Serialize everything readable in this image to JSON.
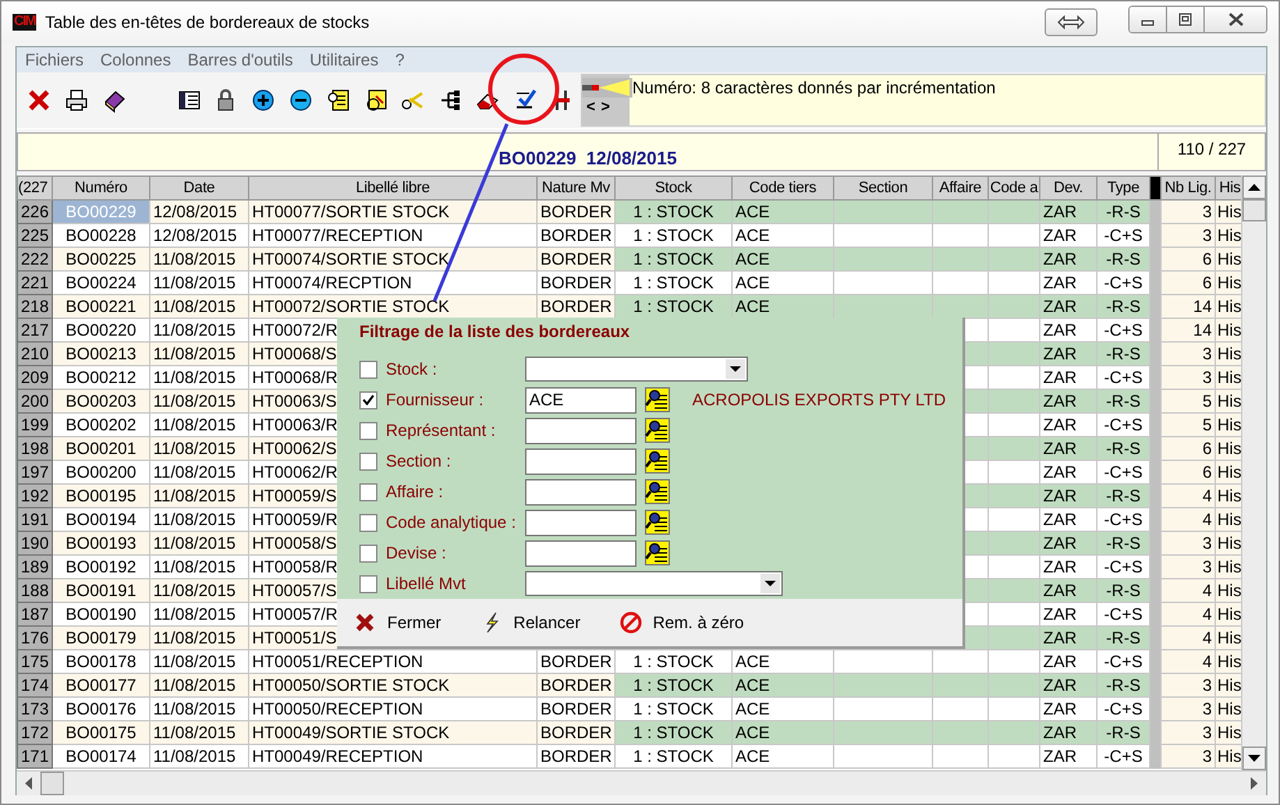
{
  "window": {
    "logo": "CIM",
    "title": "Table des en-têtes de bordereaux de stocks"
  },
  "menu": [
    "Fichiers",
    "Colonnes",
    "Barres d'outils",
    "Utilitaires",
    "?"
  ],
  "info_panel": {
    "text": "Numéro: 8 caractères donnés par incrémentation",
    "prev": "<",
    "next": ">"
  },
  "record_bar": {
    "current": "BO00229  12/08/2015",
    "position": "110 / 227"
  },
  "table": {
    "columns": [
      "(227",
      "Numéro",
      "Date",
      "Libellé libre",
      "Nature Mv",
      "Stock",
      "Code tiers",
      "Section",
      "Affaire",
      "Code a",
      "Dev.",
      "Type",
      "Nb Lig.",
      "His"
    ],
    "rows": [
      {
        "index": "226",
        "numero": "BO00229",
        "date": "12/08/2015",
        "libelle": "HT00077/SORTIE STOCK",
        "nature": "BORDER",
        "stock": "1 : STOCK",
        "code_tiers": "ACE",
        "dev": "ZAR",
        "type": "-R-S",
        "nb": "3",
        "hist": "His",
        "selected": true
      },
      {
        "index": "225",
        "numero": "BO00228",
        "date": "12/08/2015",
        "libelle": "HT00077/RECEPTION",
        "nature": "BORDER",
        "stock": "1 : STOCK",
        "code_tiers": "ACE",
        "dev": "ZAR",
        "type": "-C+S",
        "nb": "3",
        "hist": "His",
        "selected": false
      },
      {
        "index": "222",
        "numero": "BO00225",
        "date": "11/08/2015",
        "libelle": "HT00074/SORTIE STOCK",
        "nature": "BORDER",
        "stock": "1 : STOCK",
        "code_tiers": "ACE",
        "dev": "ZAR",
        "type": "-R-S",
        "nb": "6",
        "hist": "His",
        "selected": false
      },
      {
        "index": "221",
        "numero": "BO00224",
        "date": "11/08/2015",
        "libelle": "HT00074/RECPTION",
        "nature": "BORDER",
        "stock": "1 : STOCK",
        "code_tiers": "ACE",
        "dev": "ZAR",
        "type": "-C+S",
        "nb": "6",
        "hist": "His",
        "selected": false
      },
      {
        "index": "218",
        "numero": "BO00221",
        "date": "11/08/2015",
        "libelle": "HT00072/SORTIE STOCK",
        "nature": "BORDER",
        "stock": "1 : STOCK",
        "code_tiers": "ACE",
        "dev": "ZAR",
        "type": "-R-S",
        "nb": "14",
        "hist": "His",
        "selected": false
      },
      {
        "index": "217",
        "numero": "BO00220",
        "date": "11/08/2015",
        "libelle": "HT00072/R",
        "dev": "ZAR",
        "type": "-C+S",
        "nb": "14",
        "hist": "His",
        "selected": false
      },
      {
        "index": "210",
        "numero": "BO00213",
        "date": "11/08/2015",
        "libelle": "HT00068/S",
        "dev": "ZAR",
        "type": "-R-S",
        "nb": "3",
        "hist": "His",
        "selected": false
      },
      {
        "index": "209",
        "numero": "BO00212",
        "date": "11/08/2015",
        "libelle": "HT00068/R",
        "dev": "ZAR",
        "type": "-C+S",
        "nb": "3",
        "hist": "His",
        "selected": false
      },
      {
        "index": "200",
        "numero": "BO00203",
        "date": "11/08/2015",
        "libelle": "HT00063/S",
        "dev": "ZAR",
        "type": "-R-S",
        "nb": "5",
        "hist": "His",
        "selected": false
      },
      {
        "index": "199",
        "numero": "BO00202",
        "date": "11/08/2015",
        "libelle": "HT00063/R",
        "dev": "ZAR",
        "type": "-C+S",
        "nb": "5",
        "hist": "His",
        "selected": false
      },
      {
        "index": "198",
        "numero": "BO00201",
        "date": "11/08/2015",
        "libelle": "HT00062/S",
        "dev": "ZAR",
        "type": "-R-S",
        "nb": "6",
        "hist": "His",
        "selected": false
      },
      {
        "index": "197",
        "numero": "BO00200",
        "date": "11/08/2015",
        "libelle": "HT00062/R",
        "dev": "ZAR",
        "type": "-C+S",
        "nb": "6",
        "hist": "His",
        "selected": false
      },
      {
        "index": "192",
        "numero": "BO00195",
        "date": "11/08/2015",
        "libelle": "HT00059/S",
        "dev": "ZAR",
        "type": "-R-S",
        "nb": "4",
        "hist": "His",
        "selected": false
      },
      {
        "index": "191",
        "numero": "BO00194",
        "date": "11/08/2015",
        "libelle": "HT00059/R",
        "dev": "ZAR",
        "type": "-C+S",
        "nb": "4",
        "hist": "His",
        "selected": false
      },
      {
        "index": "190",
        "numero": "BO00193",
        "date": "11/08/2015",
        "libelle": "HT00058/S",
        "dev": "ZAR",
        "type": "-R-S",
        "nb": "3",
        "hist": "His",
        "selected": false
      },
      {
        "index": "189",
        "numero": "BO00192",
        "date": "11/08/2015",
        "libelle": "HT00058/R",
        "dev": "ZAR",
        "type": "-C+S",
        "nb": "3",
        "hist": "His",
        "selected": false
      },
      {
        "index": "188",
        "numero": "BO00191",
        "date": "11/08/2015",
        "libelle": "HT00057/S",
        "dev": "ZAR",
        "type": "-R-S",
        "nb": "4",
        "hist": "His",
        "selected": false
      },
      {
        "index": "187",
        "numero": "BO00190",
        "date": "11/08/2015",
        "libelle": "HT00057/R",
        "dev": "ZAR",
        "type": "-C+S",
        "nb": "4",
        "hist": "His",
        "selected": false
      },
      {
        "index": "176",
        "numero": "BO00179",
        "date": "11/08/2015",
        "libelle": "HT00051/S",
        "dev": "ZAR",
        "type": "-R-S",
        "nb": "4",
        "hist": "His",
        "selected": false
      },
      {
        "index": "175",
        "numero": "BO00178",
        "date": "11/08/2015",
        "libelle": "HT00051/RECEPTION",
        "nature": "BORDER",
        "stock": "1 : STOCK",
        "code_tiers": "ACE",
        "dev": "ZAR",
        "type": "-C+S",
        "nb": "4",
        "hist": "His",
        "selected": false
      },
      {
        "index": "174",
        "numero": "BO00177",
        "date": "11/08/2015",
        "libelle": "HT00050/SORTIE STOCK",
        "nature": "BORDER",
        "stock": "1 : STOCK",
        "code_tiers": "ACE",
        "dev": "ZAR",
        "type": "-R-S",
        "nb": "3",
        "hist": "His",
        "selected": false
      },
      {
        "index": "173",
        "numero": "BO00176",
        "date": "11/08/2015",
        "libelle": "HT00050/RECEPTION",
        "nature": "BORDER",
        "stock": "1 : STOCK",
        "code_tiers": "ACE",
        "dev": "ZAR",
        "type": "-C+S",
        "nb": "3",
        "hist": "His",
        "selected": false
      },
      {
        "index": "172",
        "numero": "BO00175",
        "date": "11/08/2015",
        "libelle": "HT00049/SORTIE STOCK",
        "nature": "BORDER",
        "stock": "1 : STOCK",
        "code_tiers": "ACE",
        "dev": "ZAR",
        "type": "-R-S",
        "nb": "3",
        "hist": "His",
        "selected": false
      },
      {
        "index": "171",
        "numero": "BO00174",
        "date": "11/08/2015",
        "libelle": "HT00049/RECEPTION",
        "nature": "BORDER",
        "stock": "1 : STOCK",
        "code_tiers": "ACE",
        "dev": "ZAR",
        "type": "-C+S",
        "nb": "3",
        "hist": "His",
        "selected": false
      }
    ]
  },
  "filter_dialog": {
    "title": "Filtrage de la liste des bordereaux",
    "fields": [
      {
        "kind": "select",
        "label": "Stock :",
        "checked": false
      },
      {
        "kind": "lookup",
        "label": "Fournisseur :",
        "checked": true,
        "value": "ACE",
        "description": "ACROPOLIS EXPORTS PTY LTD"
      },
      {
        "kind": "lookup",
        "label": "Représentant :",
        "checked": false
      },
      {
        "kind": "lookup",
        "label": "Section :",
        "checked": false
      },
      {
        "kind": "lookup",
        "label": "Affaire :",
        "checked": false
      },
      {
        "kind": "lookup",
        "label": "Code analytique :",
        "checked": false
      },
      {
        "kind": "lookup",
        "label": "Devise :",
        "checked": false
      },
      {
        "kind": "wideselect",
        "label": "Libellé Mvt",
        "checked": false
      }
    ],
    "buttons": [
      {
        "kind": "close",
        "label": "Fermer"
      },
      {
        "kind": "rerun",
        "label": "Relancer"
      },
      {
        "kind": "reset",
        "label": "Rem. à zéro"
      }
    ]
  }
}
